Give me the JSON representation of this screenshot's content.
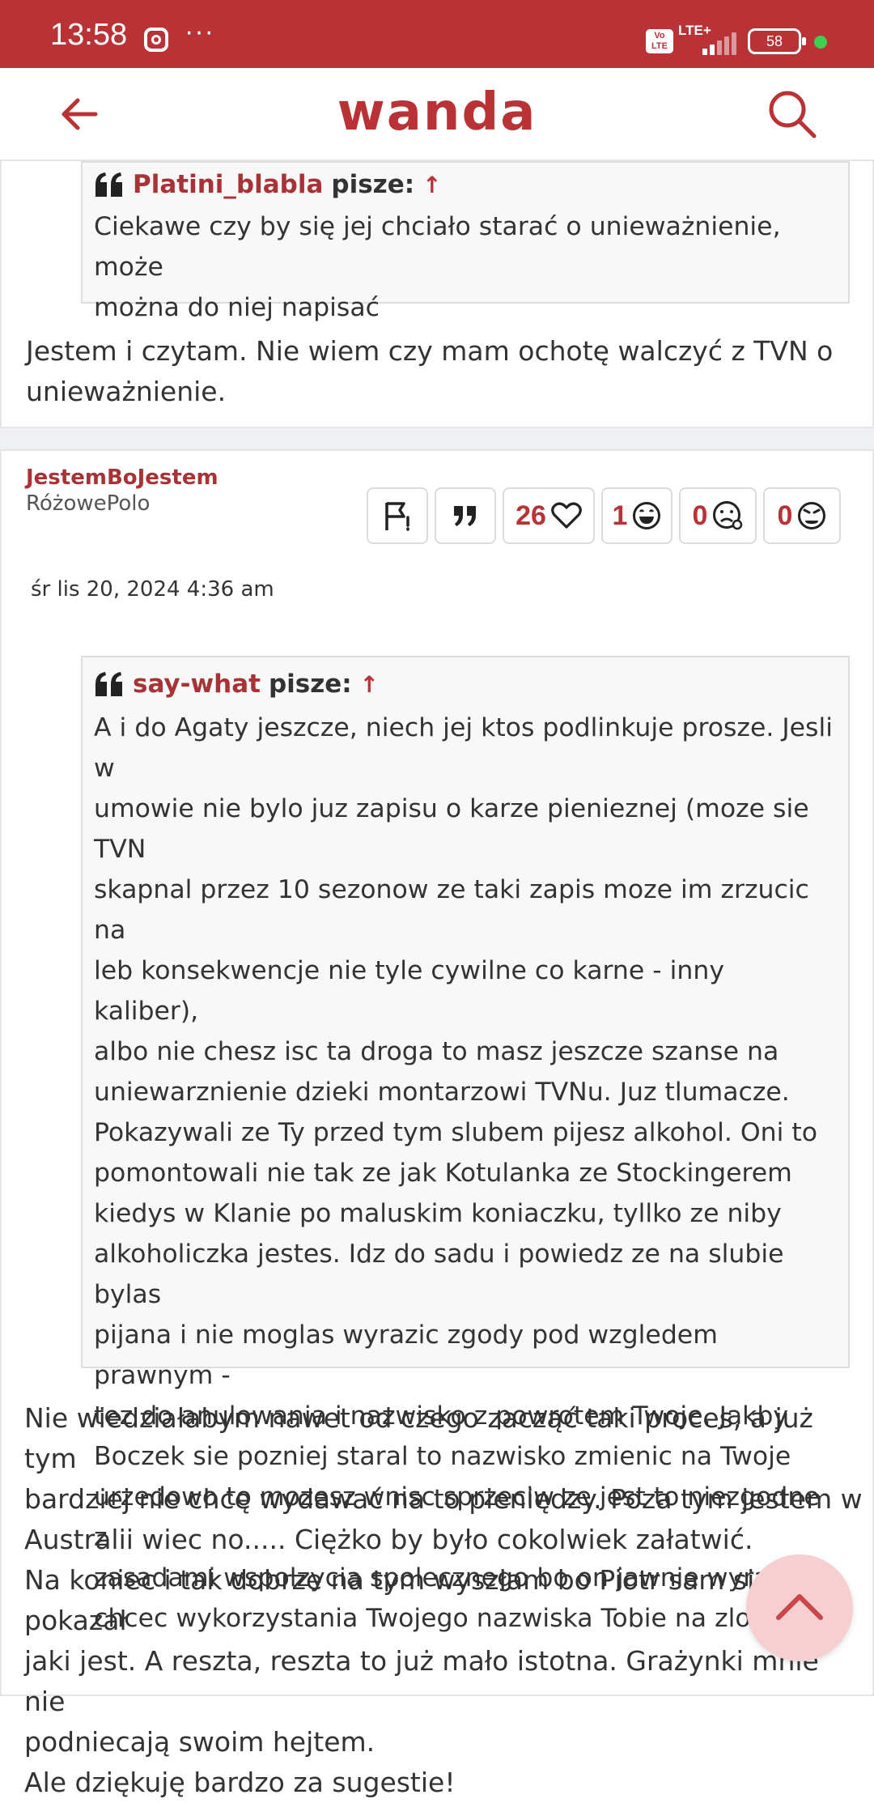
{
  "status_bar": {
    "time": "13:58",
    "overflow": "···",
    "volte": "Vo LTE",
    "network": "LTE+",
    "battery": "58"
  },
  "header": {
    "logo": "wanda",
    "back_icon": "arrow-left-icon",
    "search_icon": "search-icon"
  },
  "post1": {
    "quote": {
      "author": "Platini_blabla",
      "says": "pisze:",
      "arrow": "↑",
      "text": "Ciekawe czy by się jej chciało starać o unieważnienie, może\nmożna do niej napisać"
    },
    "body": "Jestem i czytam. Nie wiem czy mam ochotę walczyć z TVN o\nunieważnienie."
  },
  "post2": {
    "author": "JestemBoJestem",
    "rank": "RóżowePolo",
    "date": "śr lis 20, 2024 4:36 am",
    "actions": {
      "likes": "26",
      "laugh": "1",
      "sad": "0",
      "angry": "0"
    },
    "quote": {
      "author": "say-what",
      "says": "pisze:",
      "arrow": "↑",
      "text": "A i do Agaty jeszcze, niech jej ktos podlinkuje prosze. Jesli w\numowie nie bylo juz zapisu o karze pienieznej (moze sie TVN\nskapnal przez 10 sezonow ze taki zapis moze im zrzucic na\nleb konsekwencje nie tyle cywilne co karne - inny kaliber),\nalbo nie chesz isc ta droga to masz jeszcze szanse na\nuniewarznienie dzieki montarzowi TVNu. Juz tlumacze.\nPokazywali ze Ty przed tym slubem pijesz alkohol. Oni to\npomontowali nie tak ze jak Kotulanka ze Stockingerem\nkiedys w Klanie po maluskim koniaczku, tyllko ze niby\nalkoholiczka jestes. Idz do sadu i powiedz ze na slubie bylas\npijana i nie moglas wyrazic zgody pod wzgledem prawnym -\ntez do anulowania i nazwisko z powrotem Twoje. Jakby\nBoczek sie pozniej staral to nazwisko zmienic na Twoje\nurzedowo to mozesz wnisc sprzeciw ze jest to niezgodne z\nzasadami wspolzycia spolecznego bo on jawnie wyrazil\nchcec wykorzystania Twojego nazwiska Tobie na zlosc."
    },
    "body": "Nie wiedziałabym nawet od czego zacząć taki proces, a już tym\nbardziej nie chcę wydawać na to pieniędzy. Poza tym jestem w\nAustralii wiec no..... Ciężko by było cokolwiek załatwić.\nNa koniec i tak dobrze na tym wyszłam bo Piotr sam się pokazał\njaki jest. A reszta, reszta to już mało istotna. Grażynki mnie nie\npodniecają swoim hejtem.\nAle dziękuję bardzo za sugestie!"
  },
  "colors": {
    "brand": "#b83236",
    "author": "#a83337",
    "fab": "#f6cfd0"
  }
}
